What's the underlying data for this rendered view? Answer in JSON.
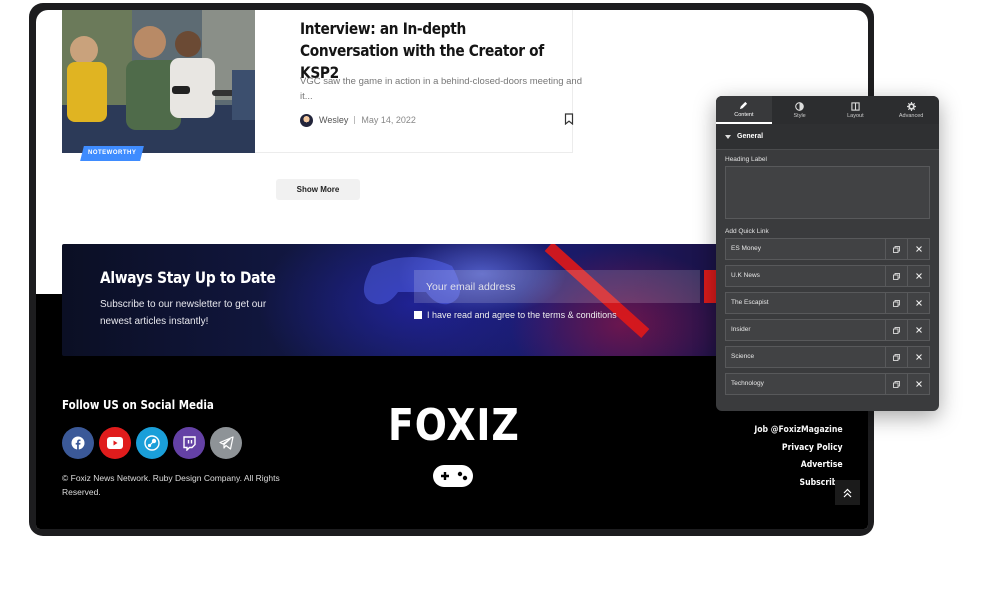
{
  "article": {
    "badge": "NOTEWORTHY",
    "title": "Interview: an In-depth Conversation with the Creator of KSP2",
    "excerpt": "VGC saw the game in action in a behind-closed-doors meeting and it...",
    "author": "Wesley",
    "date": "May 14, 2022"
  },
  "show_more_label": "Show More",
  "newsletter": {
    "title": "Always Stay Up to Date",
    "subtitle": "Subscribe to our newsletter to get our newest articles instantly!",
    "email_placeholder": "Your email address",
    "agree_text": "I have read and agree to the terms & conditions"
  },
  "footer": {
    "social_title": "Follow US on Social Media",
    "socials": [
      {
        "icon": "facebook-icon",
        "color": "#3b5998"
      },
      {
        "icon": "youtube-icon",
        "color": "#e01c1c"
      },
      {
        "icon": "steam-icon",
        "color": "#1a9fd9"
      },
      {
        "icon": "twitch-icon",
        "color": "#6441a5"
      },
      {
        "icon": "telegram-icon",
        "color": "#8e9397"
      }
    ],
    "copyright": "© Foxiz News Network. Ruby Design Company. All Rights Reserved.",
    "logo": "FOXIZ",
    "links": [
      "Job @FoxizMagazine",
      "Privacy Policy",
      "Advertise",
      "Subscribe"
    ]
  },
  "panel": {
    "tabs": [
      "Content",
      "Style",
      "Layout",
      "Advanced"
    ],
    "section": "General",
    "heading_label": "Heading Label",
    "quick_link_label": "Add Quick Link",
    "quick_links": [
      "ES Money",
      "U.K News",
      "The Escapist",
      "Insider",
      "Science",
      "Technology"
    ]
  }
}
